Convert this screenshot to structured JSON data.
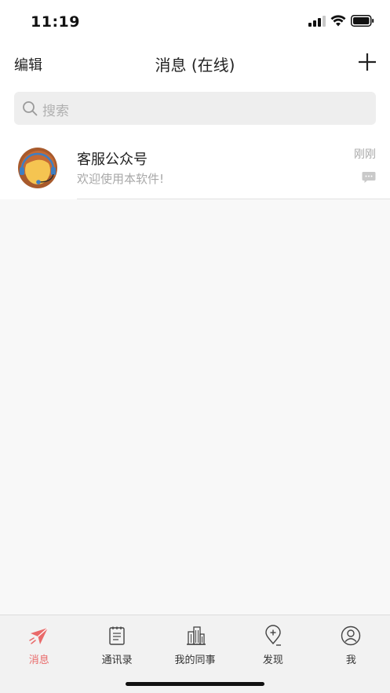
{
  "status_bar": {
    "time": "11:19",
    "icons": [
      "cellular-signal-icon",
      "wifi-icon",
      "battery-icon"
    ]
  },
  "nav": {
    "edit_label": "编辑",
    "title": "消息 (在线)",
    "add_icon": "plus-icon"
  },
  "search": {
    "placeholder": "搜索",
    "icon": "search-icon"
  },
  "messages": [
    {
      "name": "客服公众号",
      "preview": "欢迎使用本软件!",
      "time": "刚刚",
      "avatar": "customer-service-avatar",
      "status_icon": "chat-bubble-icon"
    }
  ],
  "tabs": [
    {
      "label": "消息",
      "icon": "paper-plane-icon",
      "active": true
    },
    {
      "label": "通讯录",
      "icon": "notebook-icon",
      "active": false
    },
    {
      "label": "我的同事",
      "icon": "building-icon",
      "active": false
    },
    {
      "label": "发现",
      "icon": "location-plus-icon",
      "active": false
    },
    {
      "label": "我",
      "icon": "user-circle-icon",
      "active": false
    }
  ],
  "colors": {
    "accent": "#e96a6a",
    "background": "#f8f8f8",
    "search_bg": "#eeeeee",
    "tab_bar_bg": "#f2f2f2"
  }
}
